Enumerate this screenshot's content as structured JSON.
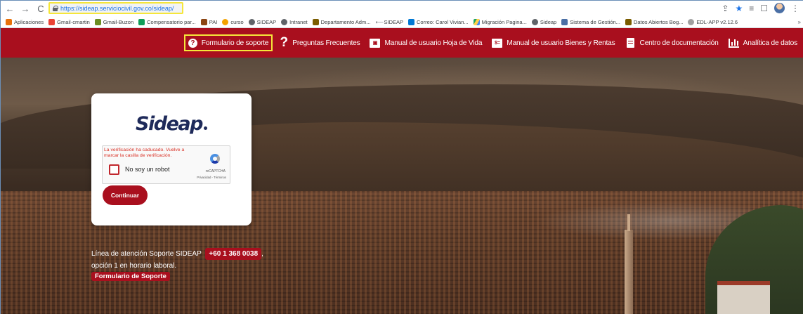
{
  "browser": {
    "url": "https://sideap.serviciocivil.gov.co/sideap/",
    "bookmarks": [
      {
        "label": "Aplicaciones",
        "icon": "apps-grid-icon",
        "color": "#e8710a"
      },
      {
        "label": "Gmail-cmartin",
        "icon": "gmail-icon",
        "color": "#ea4335"
      },
      {
        "label": "Gmail-Buzon",
        "icon": "gmail-buzon-icon",
        "color": "#6b8e23"
      },
      {
        "label": "Compensatorio par...",
        "icon": "sheet-icon",
        "color": "#0f9d58"
      },
      {
        "label": "PAI",
        "icon": "pai-icon",
        "color": "#8b4513"
      },
      {
        "label": "curso",
        "icon": "curso-icon",
        "color": "#f4a300"
      },
      {
        "label": "SIDEAP",
        "icon": "globe-icon",
        "color": "#5f6368"
      },
      {
        "label": "Intranet",
        "icon": "globe-icon",
        "color": "#5f6368"
      },
      {
        "label": "Departamento Adm...",
        "icon": "shield-icon",
        "color": "#7a5c00"
      },
      {
        "label": "SIDEAP",
        "icon": "arrow-icon",
        "color": "#5f6368"
      },
      {
        "label": "Correo: Carol Vivian...",
        "icon": "outlook-icon",
        "color": "#0078d4"
      },
      {
        "label": "Migración Pagina...",
        "icon": "drive-icon",
        "color": "#1fa463"
      },
      {
        "label": "Sideap",
        "icon": "globe-icon",
        "color": "#5f6368"
      },
      {
        "label": "Sistema de Gestión...",
        "icon": "image-icon",
        "color": "#4a6fa5"
      },
      {
        "label": "Datos Abiertos Bog...",
        "icon": "shield-icon",
        "color": "#7a5c00"
      },
      {
        "label": "EDL-APP v2.12.6",
        "icon": "edl-icon",
        "color": "#a0a0a0"
      }
    ],
    "more": "»"
  },
  "nav": {
    "items": [
      {
        "label": "Formulario de soporte",
        "icon": "help-circle-icon"
      },
      {
        "label": "Preguntas Frecuentes",
        "icon": "question-mark-icon"
      },
      {
        "label": "Manual de usuario Hoja de Vida",
        "icon": "id-card-icon"
      },
      {
        "label": "Manual de usuario Bienes y Rentas",
        "icon": "money-icon"
      },
      {
        "label": "Centro de documentación",
        "icon": "document-icon"
      },
      {
        "label": "Analítica de datos",
        "icon": "bar-chart-icon"
      }
    ]
  },
  "login": {
    "logo": "Sideap",
    "captcha": {
      "error": "La verificación ha caducado. Vuelve a marcar la casilla de verificación.",
      "label": "No soy un robot",
      "brand": "reCAPTCHA",
      "links": "Privacidad - Términos"
    },
    "continue_label": "Continuar"
  },
  "support": {
    "line_text": "Línea de atención Soporte SIDEAP",
    "phone": "+60 1 368 0038",
    "comma": ",",
    "hours": "opción 1 en horario laboral.",
    "link": "Formulario de Soporte"
  },
  "colors": {
    "brand_red": "#a90f1e",
    "highlight_yellow": "#f5e63a",
    "logo_navy": "#1e2a5a"
  }
}
